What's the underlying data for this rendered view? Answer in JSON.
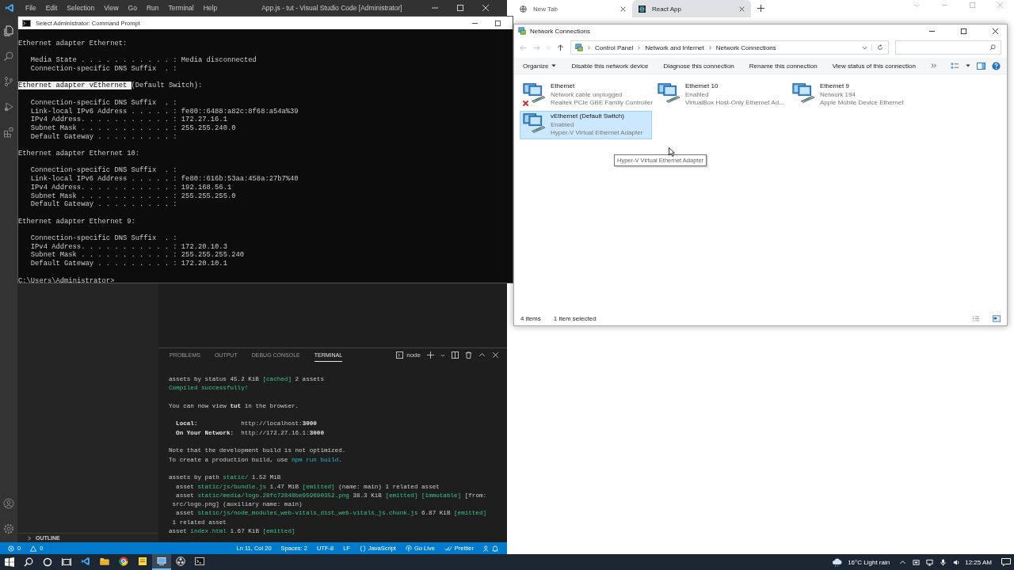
{
  "vscode": {
    "menu": [
      "File",
      "Edit",
      "Selection",
      "View",
      "Go",
      "Run",
      "Terminal",
      "Help"
    ],
    "title": "App.js - tut - Visual Studio Code [Administrator]",
    "outline": "OUTLINE",
    "panel_tabs": [
      {
        "label": "PROBLEMS",
        "selected": false
      },
      {
        "label": "OUTPUT",
        "selected": false
      },
      {
        "label": "DEBUG CONSOLE",
        "selected": false
      },
      {
        "label": "TERMINAL",
        "selected": true
      }
    ],
    "terminal_name": "node",
    "terminal": [
      [
        [
          {
            "text": "assets by status 45.2 KiB ",
            "kind": "plain"
          },
          {
            "text": "[cached]",
            "kind": "ok"
          },
          {
            "text": " 2 assets",
            "kind": "plain"
          }
        ],
        [
          {
            "text": "Compiled successfully!",
            "kind": "ok"
          }
        ]
      ],
      [
        [
          {
            "text": "You can now view ",
            "kind": "plain"
          },
          {
            "text": "tut",
            "kind": "bold"
          },
          {
            "text": " in the browser.",
            "kind": "plain"
          }
        ]
      ],
      [
        [
          {
            "text": "  Local:",
            "kind": "bold"
          },
          {
            "text": "            http://localhost:",
            "kind": "plain"
          },
          {
            "text": "3000",
            "kind": "bold"
          }
        ],
        [
          {
            "text": "  On Your Network:",
            "kind": "bold"
          },
          {
            "text": "  http://172.27.16.1:",
            "kind": "plain"
          },
          {
            "text": "3000",
            "kind": "bold"
          }
        ]
      ],
      [
        [
          {
            "text": "Note that the development build is not optimized.",
            "kind": "plain"
          }
        ],
        [
          {
            "text": "To create a production build, use ",
            "kind": "plain"
          },
          {
            "text": "npm run build",
            "kind": "link"
          },
          {
            "text": ".",
            "kind": "plain"
          }
        ]
      ],
      [
        [
          {
            "text": "assets by path ",
            "kind": "plain"
          },
          {
            "text": "static/",
            "kind": "ok"
          },
          {
            "text": " 1.52 MiB",
            "kind": "plain"
          }
        ],
        [
          {
            "text": "  asset ",
            "kind": "plain"
          },
          {
            "text": "static/js/bundle.js",
            "kind": "ok"
          },
          {
            "text": " 1.47 MiB ",
            "kind": "plain"
          },
          {
            "text": "[emitted]",
            "kind": "ok"
          },
          {
            "text": " (name: main) 1 related asset",
            "kind": "plain"
          }
        ],
        [
          {
            "text": "  asset ",
            "kind": "plain"
          },
          {
            "text": "static/media/logo.28fc72848be959690352.png",
            "kind": "ok"
          },
          {
            "text": " 38.3 KiB ",
            "kind": "plain"
          },
          {
            "text": "[emitted] [immutable]",
            "kind": "ok"
          },
          {
            "text": " [from:",
            "kind": "plain"
          }
        ],
        [
          {
            "text": " src/logo.png] (auxiliary name: main)",
            "kind": "plain"
          }
        ],
        [
          {
            "text": "  asset ",
            "kind": "plain"
          },
          {
            "text": "static/js/node_modules_web-vitals_dist_web-vitals_js.chunk.js",
            "kind": "ok"
          },
          {
            "text": " 6.87 KiB ",
            "kind": "plain"
          },
          {
            "text": "[emitted]",
            "kind": "ok"
          }
        ],
        [
          {
            "text": " 1 related asset",
            "kind": "plain"
          }
        ],
        [
          {
            "text": "asset ",
            "kind": "plain"
          },
          {
            "text": "index.html",
            "kind": "ok"
          },
          {
            "text": " 1.67 KiB ",
            "kind": "plain"
          },
          {
            "text": "[emitted]",
            "kind": "ok"
          }
        ]
      ]
    ],
    "status_bar": {
      "errors": "0",
      "warnings": "0",
      "items": [
        {
          "text": "Ln 11, Col 20",
          "kind": "plain"
        },
        {
          "text": "Spaces: 2",
          "kind": "plain"
        },
        {
          "text": "UTF-8",
          "kind": "plain"
        },
        {
          "text": "LF",
          "kind": "plain"
        },
        {
          "text": "JavaScript",
          "kind": "lang"
        },
        {
          "text": "Go Live",
          "kind": "live"
        },
        {
          "text": "Prettier",
          "kind": "prettier"
        }
      ]
    }
  },
  "browser": {
    "tabs": [
      {
        "title": "New Tab",
        "kind": "newtab",
        "selected": false
      },
      {
        "title": "React App",
        "kind": "react",
        "selected": true
      }
    ]
  },
  "cmd": {
    "title": "Select Administrator: Command Prompt",
    "sections": [
      {
        "heading": "Ethernet adapter Ethernet:",
        "lines": [
          "Media State . . . . . . . . . . . : Media disconnected",
          "Connection-specific DNS Suffix  . :"
        ]
      },
      {
        "selected_text": "Ethernet adapter vEthernet ",
        "heading": "(Default Switch):",
        "lines": [
          "Connection-specific DNS Suffix  . :",
          "Link-local IPv6 Address . . . . . : fe80::6488:a82c:8f68:a54a%39",
          "IPv4 Address. . . . . . . . . . . : 172.27.16.1",
          "Subnet Mask . . . . . . . . . . . : 255.255.240.0",
          "Default Gateway . . . . . . . . . :"
        ]
      },
      {
        "heading": "Ethernet adapter Ethernet 10:",
        "lines": [
          "Connection-specific DNS Suffix  . :",
          "Link-local IPv6 Address . . . . . : fe80::616b:53aa:458a:27b7%40",
          "IPv4 Address. . . . . . . . . . . : 192.168.56.1",
          "Subnet Mask . . . . . . . . . . . : 255.255.255.0",
          "Default Gateway . . . . . . . . . :"
        ]
      },
      {
        "heading": "Ethernet adapter Ethernet 9:",
        "lines": [
          "Connection-specific DNS Suffix  . :",
          "IPv4 Address. . . . . . . . . . . : 172.20.10.3",
          "Subnet Mask . . . . . . . . . . . : 255.255.255.240",
          "Default Gateway . . . . . . . . . : 172.20.10.1"
        ]
      }
    ],
    "prompt": "C:\\Users\\Administrator>"
  },
  "network": {
    "title": "Network Connections",
    "breadcrumbs": [
      "Control Panel",
      "Network and Internet",
      "Network Connections"
    ],
    "commands": [
      "Organize",
      "Disable this network device",
      "Diagnose this connection",
      "Rename this connection",
      "View status of this connection"
    ],
    "items": [
      {
        "name": "Ethernet",
        "status": "Network cable unplugged",
        "device": "Realtek PCIe GBE Family Controller",
        "disconnected": true,
        "selected": false
      },
      {
        "name": "Ethernet 10",
        "status": "Enabled",
        "device": "VirtualBox Host-Only Ethernet Ad...",
        "disconnected": false,
        "selected": false
      },
      {
        "name": "Ethernet 9",
        "status": "Network 194",
        "device": "Apple Mobile Device Ethernet",
        "disconnected": false,
        "selected": false
      },
      {
        "name": "vEthernet (Default Switch)",
        "status": "Enabled",
        "device": "Hyper-V Virtual Ethernet Adapter",
        "disconnected": false,
        "selected": true
      }
    ],
    "tooltip": "Hyper-V Virtual Ethernet Adapter",
    "status": {
      "count": "4 items",
      "selection": "1 item selected"
    }
  },
  "taskbar": {
    "apps": [
      {
        "kind": "code",
        "selected": false
      },
      {
        "kind": "folder",
        "selected": false
      },
      {
        "kind": "browser",
        "selected": false
      },
      {
        "kind": "notes",
        "selected": false
      },
      {
        "kind": "network",
        "selected": true
      },
      {
        "kind": "record",
        "selected": false
      },
      {
        "kind": "console",
        "selected": false
      }
    ],
    "weather": "16°C Light rain",
    "time": "12:25 AM"
  }
}
